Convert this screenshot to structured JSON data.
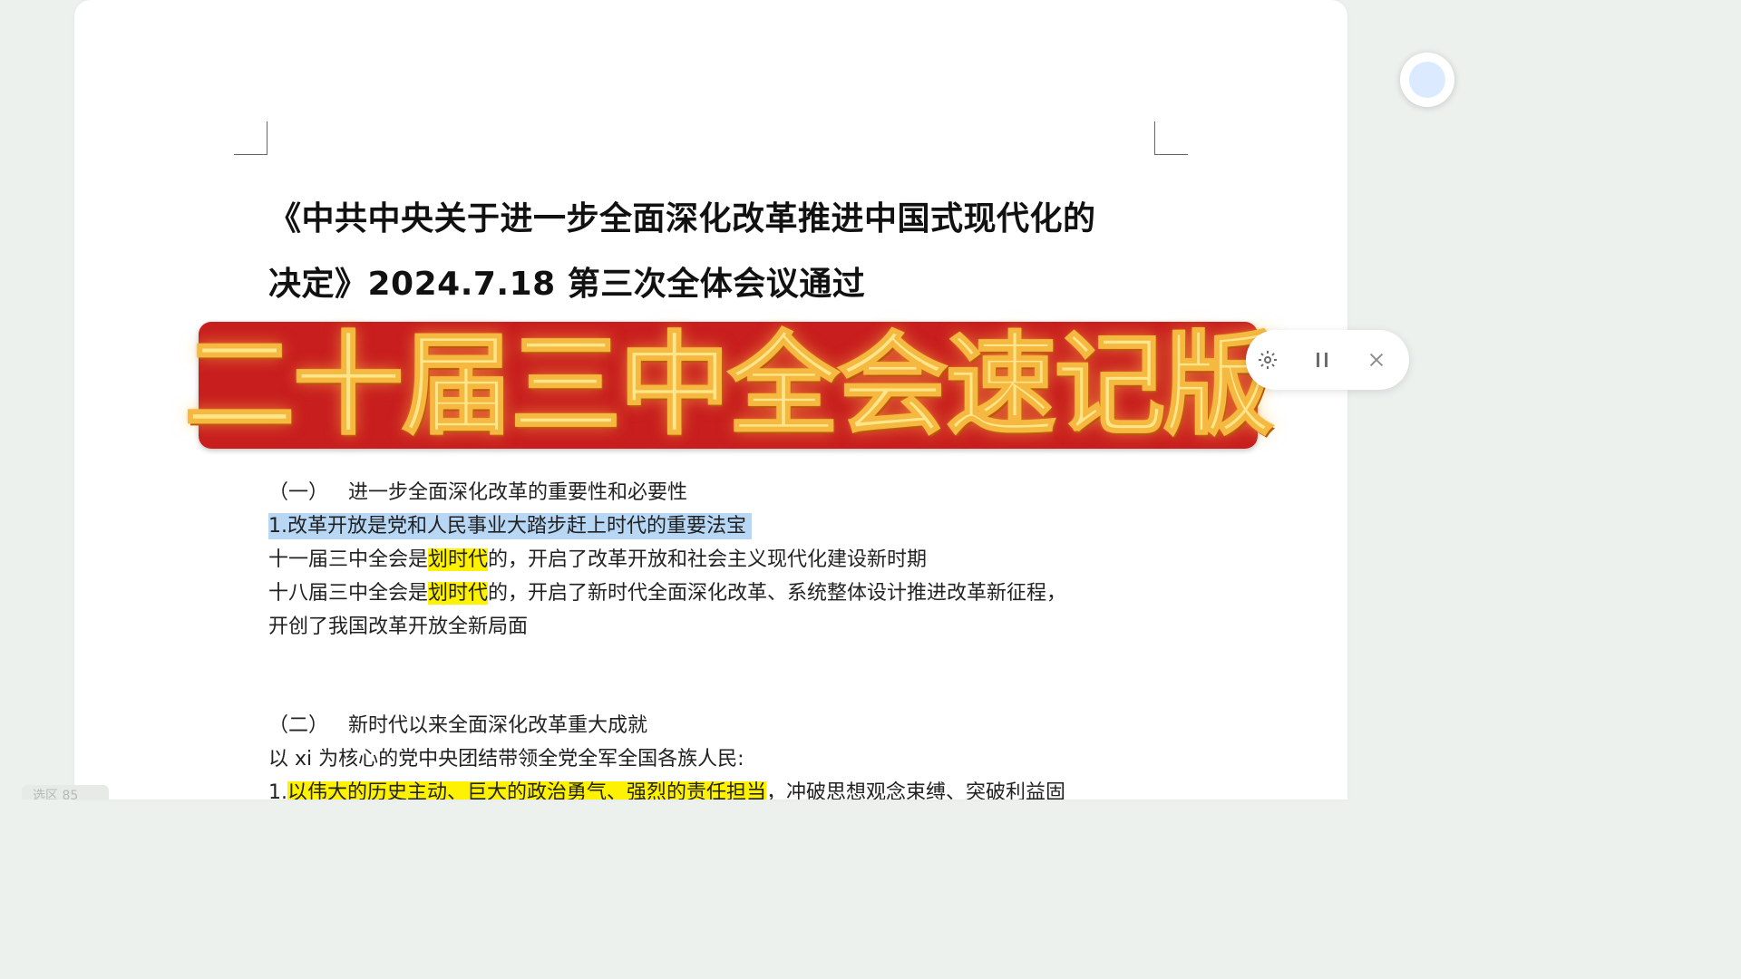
{
  "document": {
    "title_line1": "《中共中央关于进一步全面深化改革推进中国式现代化的",
    "title_line2": "决定》2024.7.18 第三次全体会议通过",
    "banner": "二十届三中全会速记版",
    "section1": {
      "heading_num": "（一）",
      "heading_text": "进一步全面深化改革的重要性和必要性",
      "item1": "1.改革开放是党和人民事业大踏步赶上时代的重要法宝",
      "line2_pre": "十一届三中全会是",
      "line2_hl": "划时代",
      "line2_post": "的，开启了改革开放和社会主义现代化建设新时期",
      "line3_pre": "十八届三中全会是",
      "line3_hl": "划时代",
      "line3_post": "的，开启了新时代全面深化改革、系统整体设计推进改革新征程，",
      "line4": "开创了我国改革开放全新局面"
    },
    "section2": {
      "heading_num": "（二）",
      "heading_text": "新时代以来全面深化改革重大成就",
      "line1": "以 xi 为核心的党中央团结带领全党全军全国各族人民:",
      "line2_num": "1.",
      "line2_hl": "以伟大的历史主动、巨大的政治勇气、强烈的责任担当",
      "line2_post": "，冲破思想观念束缚、突破利益固"
    }
  },
  "float_toolbar": {
    "icons": [
      "settings-icon",
      "pause-icon",
      "close-icon"
    ]
  },
  "footer": {
    "label": "选区 85"
  },
  "colors": {
    "banner_bg": "#c81e1e",
    "banner_text": "#fde68a",
    "highlight_yellow": "#fff200",
    "highlight_blue": "#b7d7f5"
  }
}
